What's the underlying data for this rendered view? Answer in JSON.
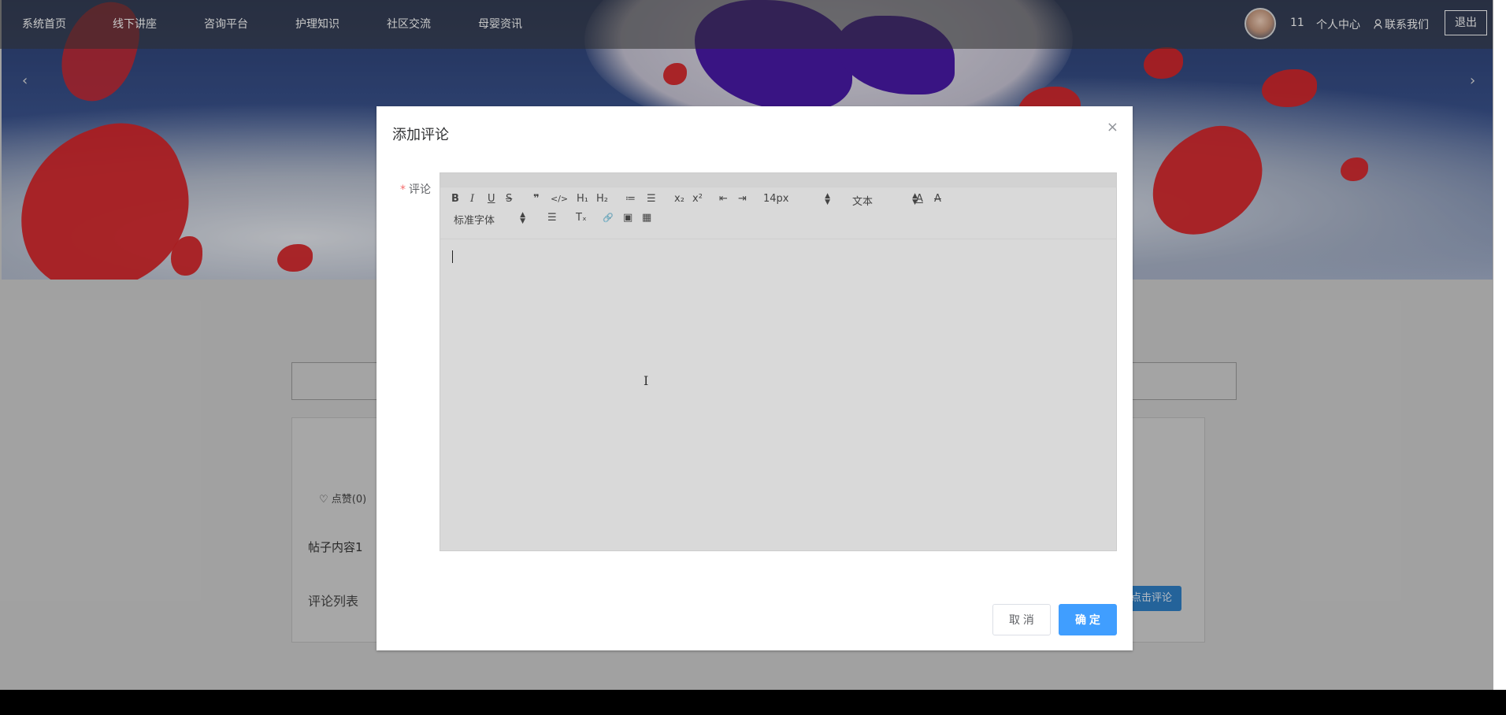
{
  "nav": {
    "items": [
      "系统首页",
      "线下讲座",
      "咨询平台",
      "护理知识",
      "社区交流",
      "母婴资讯"
    ],
    "username": "11",
    "personal_center": "个人中心",
    "contact_icon": "person-outline-icon",
    "contact": "联系我们",
    "logout": "退出"
  },
  "banner": {
    "prev_arrow": "‹",
    "next_arrow": "›"
  },
  "post": {
    "like": "♡ 点赞(0)",
    "content": "帖子内容1",
    "comment_list": "评论列表",
    "comment_button": "点击评论"
  },
  "dialog": {
    "title": "添加评论",
    "close": "×",
    "label_required": "*",
    "label": "评论",
    "toolbar": {
      "bold": "B",
      "italic": "I",
      "underline": "U",
      "strike": "S",
      "blockquote": "❞",
      "code": "</>",
      "h1": "H₁",
      "h2": "H₂",
      "ordered_list": "≔",
      "bullet_list": "☰",
      "subscript": "x₂",
      "superscript": "x²",
      "outdent": "⇤",
      "indent": "⇥",
      "size": "14px",
      "header": "文本",
      "color": "A",
      "background": "A",
      "font": "标准字体",
      "align": "☰",
      "clean": "Tₓ",
      "link": "🔗",
      "image": "▣",
      "video": "▦"
    },
    "cancel": "取 消",
    "confirm": "确 定"
  },
  "colors": {
    "primary": "#409eff",
    "required": "#f56c6c",
    "petal": "#d8262a"
  }
}
